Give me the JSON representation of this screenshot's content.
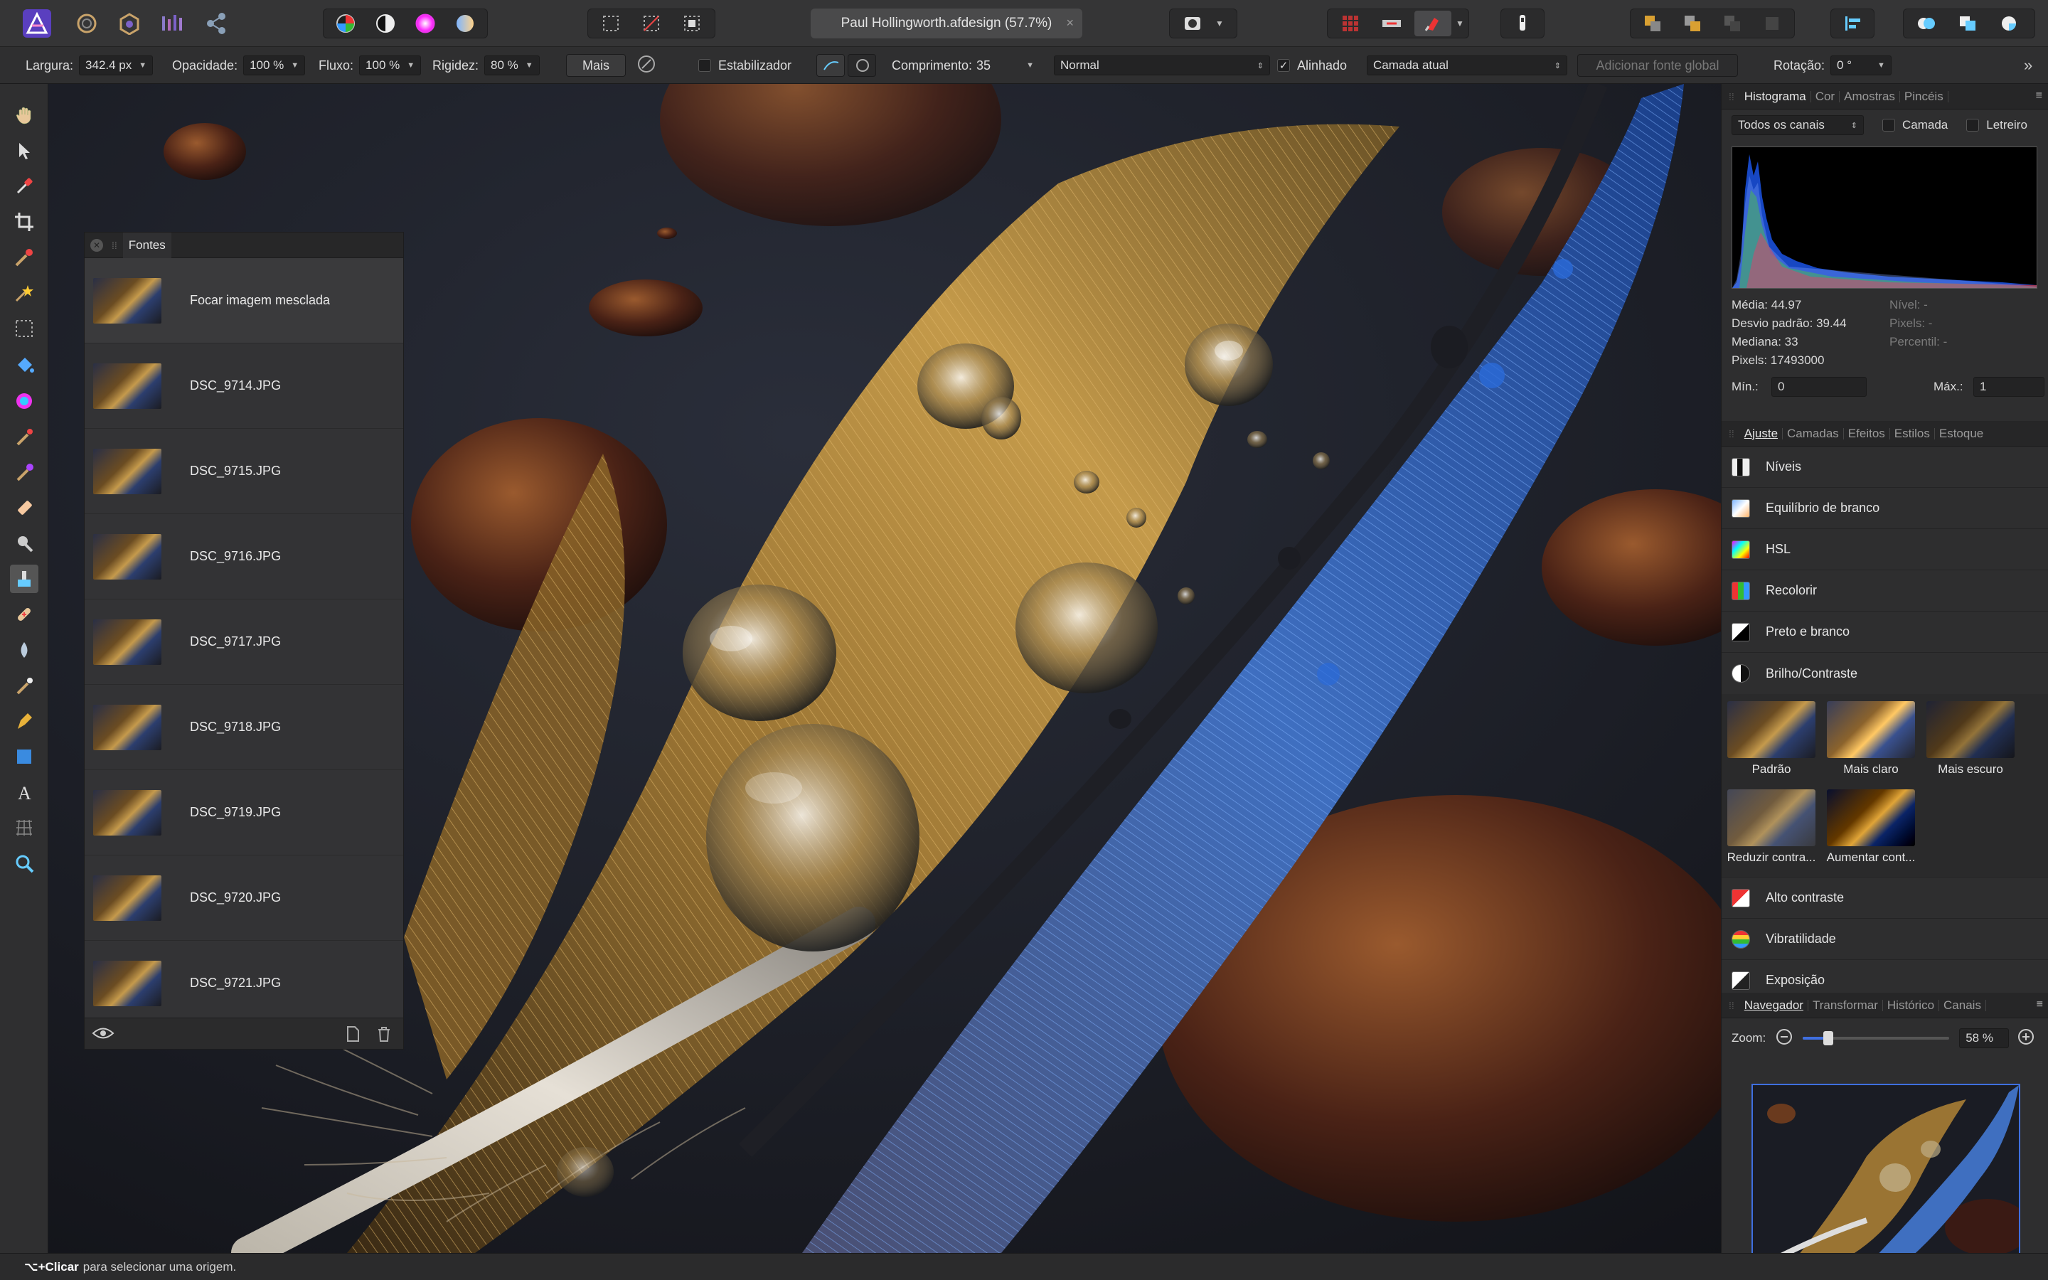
{
  "app": {
    "document_title": "Paul Hollingworth.afdesign (57.7%)",
    "close_glyph": "×"
  },
  "toolbar": {
    "persona_icons": [
      "photo-persona-icon",
      "liquify-persona-icon",
      "develop-persona-icon",
      "tone-mapping-persona-icon",
      "export-persona-icon"
    ],
    "view_icons": [
      "color-wheel-icon",
      "contrast-icon",
      "hsl-icon",
      "white-balance-icon"
    ],
    "selection_icons": [
      "marquee-icon",
      "clear-selection-icon",
      "invert-selection-icon"
    ],
    "right_icons": [
      "quick-mask-icon",
      "grid-icon",
      "snapping-icon",
      "magnet-icon",
      "assistant-icon",
      "arrange-icon",
      "order-icon",
      "align-icon",
      "boolean-icon"
    ]
  },
  "context": {
    "width_label": "Largura:",
    "width_value": "342.4 px",
    "opacity_label": "Opacidade:",
    "opacity_value": "100 %",
    "flow_label": "Fluxo:",
    "flow_value": "100 %",
    "hardness_label": "Rigidez:",
    "hardness_value": "80 %",
    "more_label": "Mais",
    "stabilizer_label": "Estabilizador",
    "length_label": "Comprimento:",
    "length_value": "35",
    "blend_mode": "Normal",
    "aligned_label": "Alinhado",
    "sample_mode": "Camada atual",
    "global_source_label": "Adicionar fonte global",
    "rotation_label": "Rotação:",
    "rotation_value": "0 °",
    "arrows_glyph": "»"
  },
  "sources": {
    "title": "Fontes",
    "items": [
      {
        "label": "Focar imagem mesclada"
      },
      {
        "label": "DSC_9714.JPG"
      },
      {
        "label": "DSC_9715.JPG"
      },
      {
        "label": "DSC_9716.JPG"
      },
      {
        "label": "DSC_9717.JPG"
      },
      {
        "label": "DSC_9718.JPG"
      },
      {
        "label": "DSC_9719.JPG"
      },
      {
        "label": "DSC_9720.JPG"
      },
      {
        "label": "DSC_9721.JPG"
      }
    ]
  },
  "histogram_panel": {
    "tabs": [
      "Histograma",
      "Cor",
      "Amostras",
      "Pincéis"
    ],
    "channel": "Todos os canais",
    "layer_label": "Camada",
    "marquee_label": "Letreiro",
    "mean": "Média: 44.97",
    "std_dev": "Desvio padrão: 39.44",
    "median": "Mediana: 33",
    "pixels_count": "Pixels: 17493000",
    "level": "Nível: -",
    "pixels_sel": "Pixels: -",
    "percentile": "Percentil: -",
    "min_label": "Mín.:",
    "min_value": "0",
    "max_label": "Máx.:",
    "max_value": "1"
  },
  "adjust_panel": {
    "tabs": [
      "Ajuste",
      "Camadas",
      "Efeitos",
      "Estilos",
      "Estoque"
    ],
    "items_top": [
      {
        "label": "Níveis",
        "icon": "levels-icon"
      },
      {
        "label": "Equilíbrio de branco",
        "icon": "white-balance-icon"
      },
      {
        "label": "HSL",
        "icon": "hsl-icon"
      },
      {
        "label": "Recolorir",
        "icon": "recolor-icon"
      },
      {
        "label": "Preto e branco",
        "icon": "black-white-icon"
      },
      {
        "label": "Brilho/Contraste",
        "icon": "brightness-contrast-icon"
      }
    ],
    "presets": [
      {
        "label": "Padrão"
      },
      {
        "label": "Mais claro"
      },
      {
        "label": "Mais escuro"
      },
      {
        "label": "Reduzir contra..."
      },
      {
        "label": "Aumentar cont..."
      }
    ],
    "items_bottom": [
      {
        "label": "Alto contraste",
        "icon": "high-contrast-icon"
      },
      {
        "label": "Vibratilidade",
        "icon": "vibrance-icon"
      },
      {
        "label": "Exposição",
        "icon": "exposure-icon"
      }
    ]
  },
  "navigator_panel": {
    "tabs": [
      "Navegador",
      "Transformar",
      "Histórico",
      "Canais"
    ],
    "zoom_label": "Zoom:",
    "zoom_value": "58 %",
    "zoom_level": 0.58
  },
  "status": {
    "shortcut": "⌥+Clicar",
    "message": "para selecionar uma origem."
  },
  "colors": {
    "accent": "#3f6fe0",
    "panel": "#2e2e2f"
  }
}
